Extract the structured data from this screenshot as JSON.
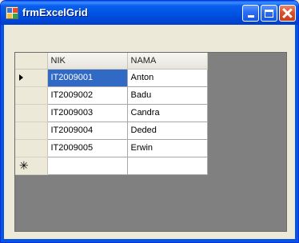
{
  "window": {
    "title": "frmExcelGrid"
  },
  "grid": {
    "columns": [
      "NIK",
      "NAMA"
    ],
    "rows": [
      {
        "nik": "IT2009001",
        "nama": "Anton"
      },
      {
        "nik": "IT2009002",
        "nama": "Badu"
      },
      {
        "nik": "IT2009003",
        "nama": "Candra"
      },
      {
        "nik": "IT2009004",
        "nama": "Deded"
      },
      {
        "nik": "IT2009005",
        "nama": "Erwin"
      }
    ],
    "new_row_glyph": "✳",
    "selected_cell": "IT2009001"
  },
  "colors": {
    "selection": "#316ac5",
    "grid_background": "#808080",
    "title_bar": "#0055e5"
  },
  "icons": {
    "app": "excel-grid-icon",
    "minimize": "minimize-icon",
    "maximize": "maximize-icon",
    "close": "close-icon",
    "current_row": "current-row-arrow-icon",
    "new_row": "new-row-asterisk-icon"
  }
}
